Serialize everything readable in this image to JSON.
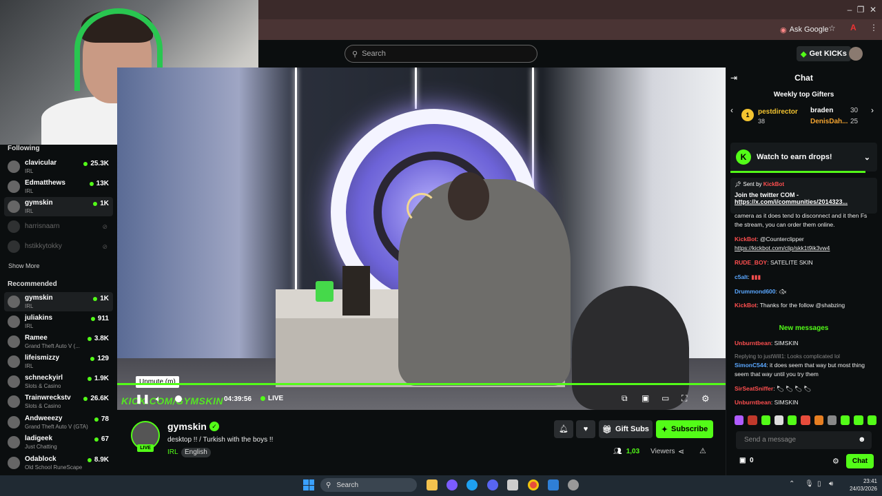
{
  "browser": {
    "ask_google": "Ask Google",
    "controls": [
      "–",
      "❐",
      "✕"
    ]
  },
  "topnav": {
    "search_placeholder": "Search",
    "get_kicks": "Get KICKs"
  },
  "sidebar": {
    "following_title": "Following",
    "following": [
      {
        "name": "clavicular",
        "category": "IRL",
        "viewers": "25.3K",
        "online": true
      },
      {
        "name": "Edmatthews",
        "category": "IRL",
        "viewers": "13K",
        "online": true
      },
      {
        "name": "gymskin",
        "category": "IRL",
        "viewers": "1K",
        "online": true,
        "active": true
      },
      {
        "name": "harrisnaarn",
        "online": false
      },
      {
        "name": "hstikkytokky",
        "online": false
      }
    ],
    "show_more": "Show More",
    "recommended_title": "Recommended",
    "recommended": [
      {
        "name": "gymskin",
        "category": "IRL",
        "viewers": "1K"
      },
      {
        "name": "juliakins",
        "category": "IRL",
        "viewers": "911"
      },
      {
        "name": "Ramee",
        "category": "Grand Theft Auto V (...",
        "viewers": "3.8K"
      },
      {
        "name": "lifeismizzy",
        "category": "IRL",
        "viewers": "129"
      },
      {
        "name": "schneckyirl",
        "category": "Slots & Casino",
        "viewers": "1.9K"
      },
      {
        "name": "Trainwreckstv",
        "category": "Slots & Casino",
        "viewers": "26.6K"
      },
      {
        "name": "Andweeezy",
        "category": "Grand Theft Auto V (GTA)",
        "viewers": "78"
      },
      {
        "name": "ladigeek",
        "category": "Just Chatting",
        "viewers": "67"
      },
      {
        "name": "Odablock",
        "category": "Old School RuneScape",
        "viewers": "8.9K"
      }
    ]
  },
  "player": {
    "tooltip": "Unmute (m)",
    "timecode": "04:39:56",
    "live_label": "LIVE",
    "watermark": "KICK.COM/GYMSKIN"
  },
  "stream": {
    "channel": "gymskin",
    "live_badge": "LIVE",
    "title": "desktop !! / Turkish with the boys !!",
    "category": "IRL",
    "language": "English",
    "gift_subs": "Gift Subs",
    "subscribe": "Subscribe",
    "viewer_count": "1,03",
    "viewers_label": "Viewers"
  },
  "chat": {
    "title": "Chat",
    "gifters_title": "Weekly top Gifters",
    "gifters": [
      {
        "name": "pestdirector",
        "count": "38",
        "rank": "1"
      },
      {
        "name": "braden",
        "count": "30"
      },
      {
        "name": "DenisDah...",
        "count": "25"
      }
    ],
    "drops": "Watch to earn drops!",
    "pinned": {
      "sent_by_label": "Sent by",
      "sender": "KickBot",
      "text": "Join the twitter COM -",
      "link": "https://x.com/i/communities/2014323..."
    },
    "messages_top": [
      {
        "user": "",
        "text": "camera as it does tend to disconnect and it then Fs the stream, you can order them online.",
        "color": "#eeeeee"
      },
      {
        "user": "KickBot",
        "text": "@Counterclipper",
        "link": "https://kickbot.com/clip/skk1t9ik3vw4",
        "color": "#ff4f4f"
      },
      {
        "user": "RUDE_BOY",
        "text": "SATELITE SKIN",
        "color": "#ff4f4f"
      },
      {
        "user": "c5alt",
        "text": "",
        "color": "#5aa7ff"
      },
      {
        "user": "Drummond600",
        "text": "",
        "color": "#5aa7ff"
      },
      {
        "user": "KickBot",
        "text": "Thanks for the follow @shabzing",
        "color": "#ff4f4f"
      }
    ],
    "new_messages": "New messages",
    "messages_bottom": [
      {
        "user": "Unburntbean",
        "text": "SIMSKIN",
        "color": "#ff4f4f"
      },
      {
        "reply": "Replying to justWill1: Looks complicated lol",
        "user": "SimonC544",
        "text": "it does seem that way but most thing seem that way until you try them",
        "color": "#5aa7ff"
      },
      {
        "user": "SirSeatSniffer",
        "text": "",
        "color": "#ff4f4f"
      },
      {
        "user": "Unburntbean",
        "text": "SIMSKIN",
        "color": "#ff4f4f"
      }
    ],
    "input_placeholder": "Send a message",
    "points": "0",
    "send_button": "Chat"
  },
  "taskbar": {
    "search": "Search",
    "time": "23:41",
    "date": "24/03/2026"
  },
  "colors": {
    "accent": "#53fc18",
    "bg": "#0b0e0f"
  }
}
